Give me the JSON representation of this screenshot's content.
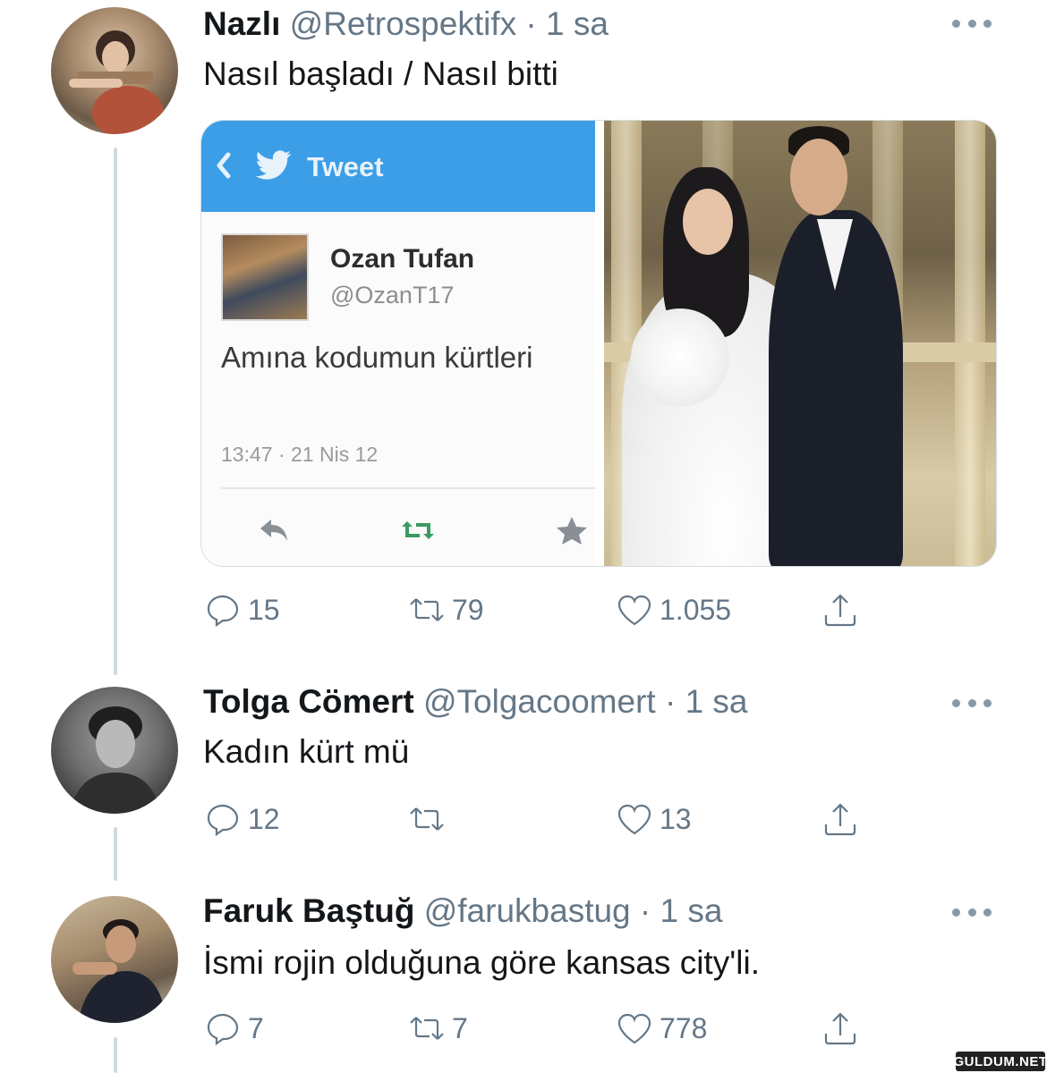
{
  "tweets": [
    {
      "name": "Nazlı",
      "handle": "@Retrospektifx",
      "separator": "·",
      "time": "1 sa",
      "text": "Nasıl başladı / Nasıl bitti",
      "avatar_icon": "user-photo",
      "counts": {
        "reply": "15",
        "retweet": "79",
        "like": "1.055"
      }
    },
    {
      "name": "Tolga Cömert",
      "handle": "@Tolgacoomert",
      "separator": "·",
      "time": "1 sa",
      "text": "Kadın kürt mü",
      "avatar_icon": "user-photo",
      "counts": {
        "reply": "12",
        "retweet": "",
        "like": "13"
      }
    },
    {
      "name": "Faruk Baştuğ",
      "handle": "@farukbastug",
      "separator": "·",
      "time": "1 sa",
      "text": "İsmi rojin olduğuna göre kansas city'li.",
      "avatar_icon": "user-photo",
      "counts": {
        "reply": "7",
        "retweet": "7",
        "like": "778"
      }
    }
  ],
  "embedded_screenshot": {
    "bar_title": "Tweet",
    "name": "Ozan Tufan",
    "handle": "@OzanT17",
    "text": "Amına kodumun kürtleri",
    "timestamp": "13:47 · 21 Nis 12",
    "bar_color": "#3b9ee6",
    "retweet_color": "#3a9a63"
  },
  "watermark": "GULDUM.NET",
  "colors": {
    "text": "#14171a",
    "muted": "#657786",
    "thread_line": "#cfd9de"
  }
}
